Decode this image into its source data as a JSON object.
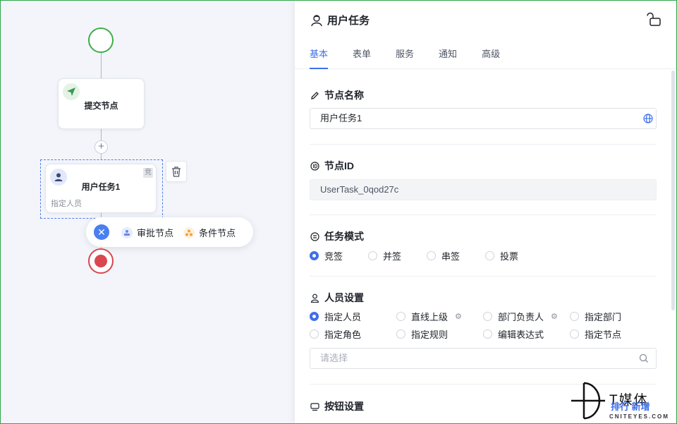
{
  "canvas": {
    "submit_node": {
      "title": "提交节点",
      "icon": "send-icon"
    },
    "task_node": {
      "title": "用户任务1",
      "badge": "竞",
      "subtitle": "指定人员",
      "icon": "user-avatar-icon"
    },
    "add_popup": {
      "items": [
        {
          "label": "审批节点",
          "icon": "approve-icon",
          "color": "#6b86e6"
        },
        {
          "label": "条件节点",
          "icon": "condition-icon",
          "color": "#f2a33a"
        }
      ]
    },
    "colors": {
      "start": "#3fae4a",
      "end": "#d9484e",
      "accent": "#4a7ff0"
    }
  },
  "panel": {
    "title": "用户任务",
    "tabs": [
      "基本",
      "表单",
      "服务",
      "通知",
      "高级"
    ],
    "active_tab": "基本",
    "node_name": {
      "label": "节点名称",
      "value": "用户任务1"
    },
    "node_id": {
      "label": "节点ID",
      "value": "UserTask_0qod27c"
    },
    "task_mode": {
      "label": "任务模式",
      "options": [
        "竞签",
        "并签",
        "串签",
        "投票"
      ],
      "selected": "竞签"
    },
    "personnel": {
      "label": "人员设置",
      "options_row1": [
        "指定人员",
        "直线上级",
        "部门负责人",
        "指定部门"
      ],
      "options_row2": [
        "指定角色",
        "指定规则",
        "编辑表达式",
        "指定节点"
      ],
      "selected": "指定人员",
      "placeholder": "请选择"
    },
    "buttons": {
      "label": "按钮设置"
    }
  },
  "watermark": {
    "title": "T媒体",
    "sub1": "排行  新增",
    "sub2": "CNITEYES.COM"
  }
}
